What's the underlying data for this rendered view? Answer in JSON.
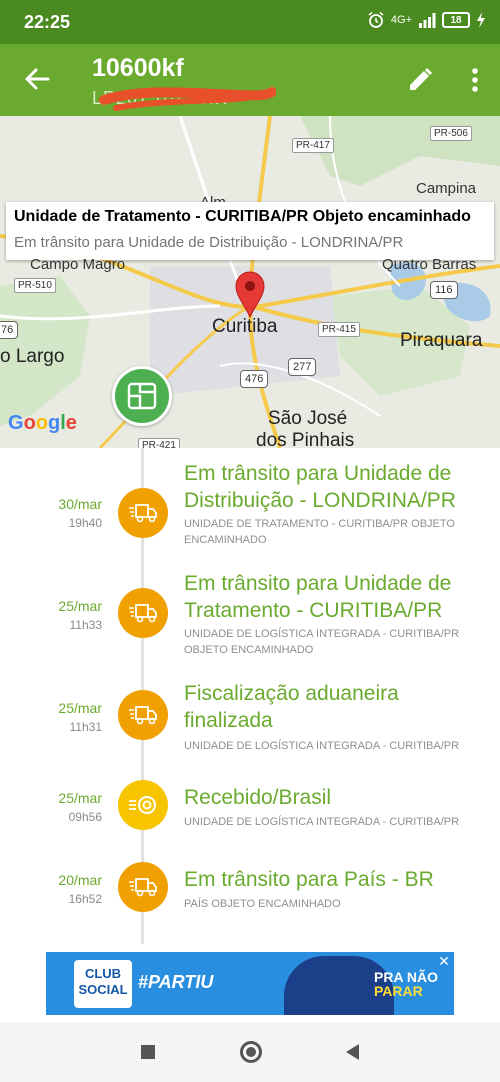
{
  "status_bar": {
    "time": "22:25",
    "network": "4G+",
    "battery": "18"
  },
  "app_bar": {
    "title": "10600kf",
    "tracking_code": "LP207 ···· THK"
  },
  "map": {
    "info_title": "Unidade de Tratamento - CURITIBA/PR Objeto encaminhado",
    "info_subtitle": "Em trânsito para Unidade de Distribuição - LONDRINA/PR",
    "places": {
      "campina": "Campina",
      "alm": "Alm",
      "campo_magro": "Campo Magro",
      "quatro_barras": "Quatro Barras",
      "curitiba": "Curitiba",
      "piraquara": "Piraquara",
      "largo": "o Largo",
      "sao_jose_1": "São José",
      "sao_jose_2": "dos Pinhais"
    },
    "roads": {
      "pr506": "PR-506",
      "pr417": "PR-417",
      "pr510": "PR-510",
      "pr415": "PR-415",
      "pr421": "PR-421",
      "br116": "116",
      "br476": "476",
      "br277": "277",
      "br76": "76"
    },
    "google_logo": "Google"
  },
  "timeline": [
    {
      "date": "30/mar",
      "time": "19h40",
      "icon": "truck-icon",
      "title": "Em trânsito para Unidade de Distribuição - LONDRINA/PR",
      "description": "UNIDADE DE TRATAMENTO - CURITIBA/PR OBJETO ENCAMINHADO"
    },
    {
      "date": "25/mar",
      "time": "11h33",
      "icon": "truck-icon",
      "title": "Em trânsito para Unidade de Tratamento - CURITIBA/PR",
      "description": "UNIDADE DE LOGÍSTICA INTEGRADA - CURITIBA/PR OBJETO ENCAMINHADO"
    },
    {
      "date": "25/mar",
      "time": "11h31",
      "icon": "truck-icon",
      "title": "Fiscalização aduaneira finalizada",
      "description": "UNIDADE DE LOGÍSTICA INTEGRADA - CURITIBA/PR"
    },
    {
      "date": "25/mar",
      "time": "09h56",
      "icon": "target-icon",
      "title": "Recebido/Brasil",
      "description": "UNIDADE DE LOGÍSTICA INTEGRADA - CURITIBA/PR"
    },
    {
      "date": "20/mar",
      "time": "16h52",
      "icon": "truck-icon",
      "title": "Em trânsito para País - BR",
      "description": "PAÍS OBJETO ENCAMINHADO"
    }
  ],
  "ad": {
    "brand_line1": "CLUB",
    "brand_line2": "SOCIAL",
    "hashtag": "#PARTIU",
    "cta_line1": "PRA NÃO",
    "cta_line2": "PARAR",
    "close": "✕"
  },
  "colors": {
    "status_bar": "#4a8a21",
    "app_bar": "#6aaa2e",
    "accent_green": "#6aaa2e",
    "icon_orange": "#f0a000",
    "icon_yellow": "#f7c400"
  }
}
